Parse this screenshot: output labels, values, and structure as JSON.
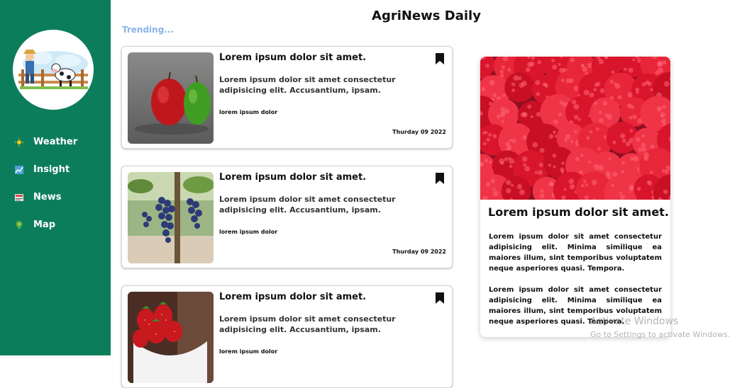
{
  "header": {
    "title": "AgriNews Daily",
    "trending_label": "Trending..."
  },
  "sidebar": {
    "items": [
      {
        "label": "Weather",
        "icon": "sun-icon"
      },
      {
        "label": "Insight",
        "icon": "chart-icon"
      },
      {
        "label": "News",
        "icon": "newspaper-icon"
      },
      {
        "label": "Map",
        "icon": "map-pin-icon"
      }
    ]
  },
  "cards": [
    {
      "title": "Lorem ipsum dolor sit amet.",
      "description": "Lorem ipsum dolor sit amet consectetur adipisicing elit. Accusantium, ipsam.",
      "tag": "lorem ipsum dolor",
      "date": "Thurday 09 2022",
      "image": "apples"
    },
    {
      "title": "Lorem ipsum dolor sit amet.",
      "description": "Lorem ipsum dolor sit amet consectetur adipisicing elit. Accusantium, ipsam.",
      "tag": "lorem ipsum dolor",
      "date": "Thurday 09 2022",
      "image": "grapes"
    },
    {
      "title": "Lorem ipsum dolor sit amet.",
      "description": "Lorem ipsum dolor sit amet consectetur adipisicing elit. Accusantium, ipsam.",
      "tag": "lorem ipsum dolor",
      "date": "",
      "image": "strawberries"
    }
  ],
  "feature": {
    "title": "Lorem ipsum dolor sit amet.",
    "paragraphs": [
      "Lorem ipsum dolor sit amet consectetur adipisicing elit. Minima similique ea maiores illum, sint temporibus voluptatem neque asperiores quasi. Tempora.",
      "Lorem ipsum dolor sit amet consectetur adipisicing elit. Minima similique ea maiores illum, sint temporibus voluptatem neque asperiores quasi. Tempora."
    ],
    "image": "raspberries"
  },
  "watermark": {
    "line1": "Activate Windows",
    "line2": "Go to Settings to activate Windows."
  },
  "colors": {
    "sidebar": "#0c7d5b",
    "trending": "#8ab4e8"
  }
}
